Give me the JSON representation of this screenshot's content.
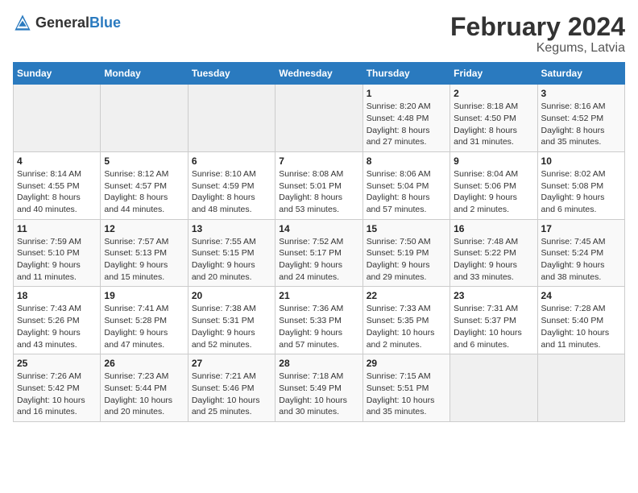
{
  "header": {
    "logo_general": "General",
    "logo_blue": "Blue",
    "title": "February 2024",
    "subtitle": "Kegums, Latvia"
  },
  "days_of_week": [
    "Sunday",
    "Monday",
    "Tuesday",
    "Wednesday",
    "Thursday",
    "Friday",
    "Saturday"
  ],
  "weeks": [
    [
      {
        "day": "",
        "info": ""
      },
      {
        "day": "",
        "info": ""
      },
      {
        "day": "",
        "info": ""
      },
      {
        "day": "",
        "info": ""
      },
      {
        "day": "1",
        "info": "Sunrise: 8:20 AM\nSunset: 4:48 PM\nDaylight: 8 hours\nand 27 minutes."
      },
      {
        "day": "2",
        "info": "Sunrise: 8:18 AM\nSunset: 4:50 PM\nDaylight: 8 hours\nand 31 minutes."
      },
      {
        "day": "3",
        "info": "Sunrise: 8:16 AM\nSunset: 4:52 PM\nDaylight: 8 hours\nand 35 minutes."
      }
    ],
    [
      {
        "day": "4",
        "info": "Sunrise: 8:14 AM\nSunset: 4:55 PM\nDaylight: 8 hours\nand 40 minutes."
      },
      {
        "day": "5",
        "info": "Sunrise: 8:12 AM\nSunset: 4:57 PM\nDaylight: 8 hours\nand 44 minutes."
      },
      {
        "day": "6",
        "info": "Sunrise: 8:10 AM\nSunset: 4:59 PM\nDaylight: 8 hours\nand 48 minutes."
      },
      {
        "day": "7",
        "info": "Sunrise: 8:08 AM\nSunset: 5:01 PM\nDaylight: 8 hours\nand 53 minutes."
      },
      {
        "day": "8",
        "info": "Sunrise: 8:06 AM\nSunset: 5:04 PM\nDaylight: 8 hours\nand 57 minutes."
      },
      {
        "day": "9",
        "info": "Sunrise: 8:04 AM\nSunset: 5:06 PM\nDaylight: 9 hours\nand 2 minutes."
      },
      {
        "day": "10",
        "info": "Sunrise: 8:02 AM\nSunset: 5:08 PM\nDaylight: 9 hours\nand 6 minutes."
      }
    ],
    [
      {
        "day": "11",
        "info": "Sunrise: 7:59 AM\nSunset: 5:10 PM\nDaylight: 9 hours\nand 11 minutes."
      },
      {
        "day": "12",
        "info": "Sunrise: 7:57 AM\nSunset: 5:13 PM\nDaylight: 9 hours\nand 15 minutes."
      },
      {
        "day": "13",
        "info": "Sunrise: 7:55 AM\nSunset: 5:15 PM\nDaylight: 9 hours\nand 20 minutes."
      },
      {
        "day": "14",
        "info": "Sunrise: 7:52 AM\nSunset: 5:17 PM\nDaylight: 9 hours\nand 24 minutes."
      },
      {
        "day": "15",
        "info": "Sunrise: 7:50 AM\nSunset: 5:19 PM\nDaylight: 9 hours\nand 29 minutes."
      },
      {
        "day": "16",
        "info": "Sunrise: 7:48 AM\nSunset: 5:22 PM\nDaylight: 9 hours\nand 33 minutes."
      },
      {
        "day": "17",
        "info": "Sunrise: 7:45 AM\nSunset: 5:24 PM\nDaylight: 9 hours\nand 38 minutes."
      }
    ],
    [
      {
        "day": "18",
        "info": "Sunrise: 7:43 AM\nSunset: 5:26 PM\nDaylight: 9 hours\nand 43 minutes."
      },
      {
        "day": "19",
        "info": "Sunrise: 7:41 AM\nSunset: 5:28 PM\nDaylight: 9 hours\nand 47 minutes."
      },
      {
        "day": "20",
        "info": "Sunrise: 7:38 AM\nSunset: 5:31 PM\nDaylight: 9 hours\nand 52 minutes."
      },
      {
        "day": "21",
        "info": "Sunrise: 7:36 AM\nSunset: 5:33 PM\nDaylight: 9 hours\nand 57 minutes."
      },
      {
        "day": "22",
        "info": "Sunrise: 7:33 AM\nSunset: 5:35 PM\nDaylight: 10 hours\nand 2 minutes."
      },
      {
        "day": "23",
        "info": "Sunrise: 7:31 AM\nSunset: 5:37 PM\nDaylight: 10 hours\nand 6 minutes."
      },
      {
        "day": "24",
        "info": "Sunrise: 7:28 AM\nSunset: 5:40 PM\nDaylight: 10 hours\nand 11 minutes."
      }
    ],
    [
      {
        "day": "25",
        "info": "Sunrise: 7:26 AM\nSunset: 5:42 PM\nDaylight: 10 hours\nand 16 minutes."
      },
      {
        "day": "26",
        "info": "Sunrise: 7:23 AM\nSunset: 5:44 PM\nDaylight: 10 hours\nand 20 minutes."
      },
      {
        "day": "27",
        "info": "Sunrise: 7:21 AM\nSunset: 5:46 PM\nDaylight: 10 hours\nand 25 minutes."
      },
      {
        "day": "28",
        "info": "Sunrise: 7:18 AM\nSunset: 5:49 PM\nDaylight: 10 hours\nand 30 minutes."
      },
      {
        "day": "29",
        "info": "Sunrise: 7:15 AM\nSunset: 5:51 PM\nDaylight: 10 hours\nand 35 minutes."
      },
      {
        "day": "",
        "info": ""
      },
      {
        "day": "",
        "info": ""
      }
    ]
  ]
}
